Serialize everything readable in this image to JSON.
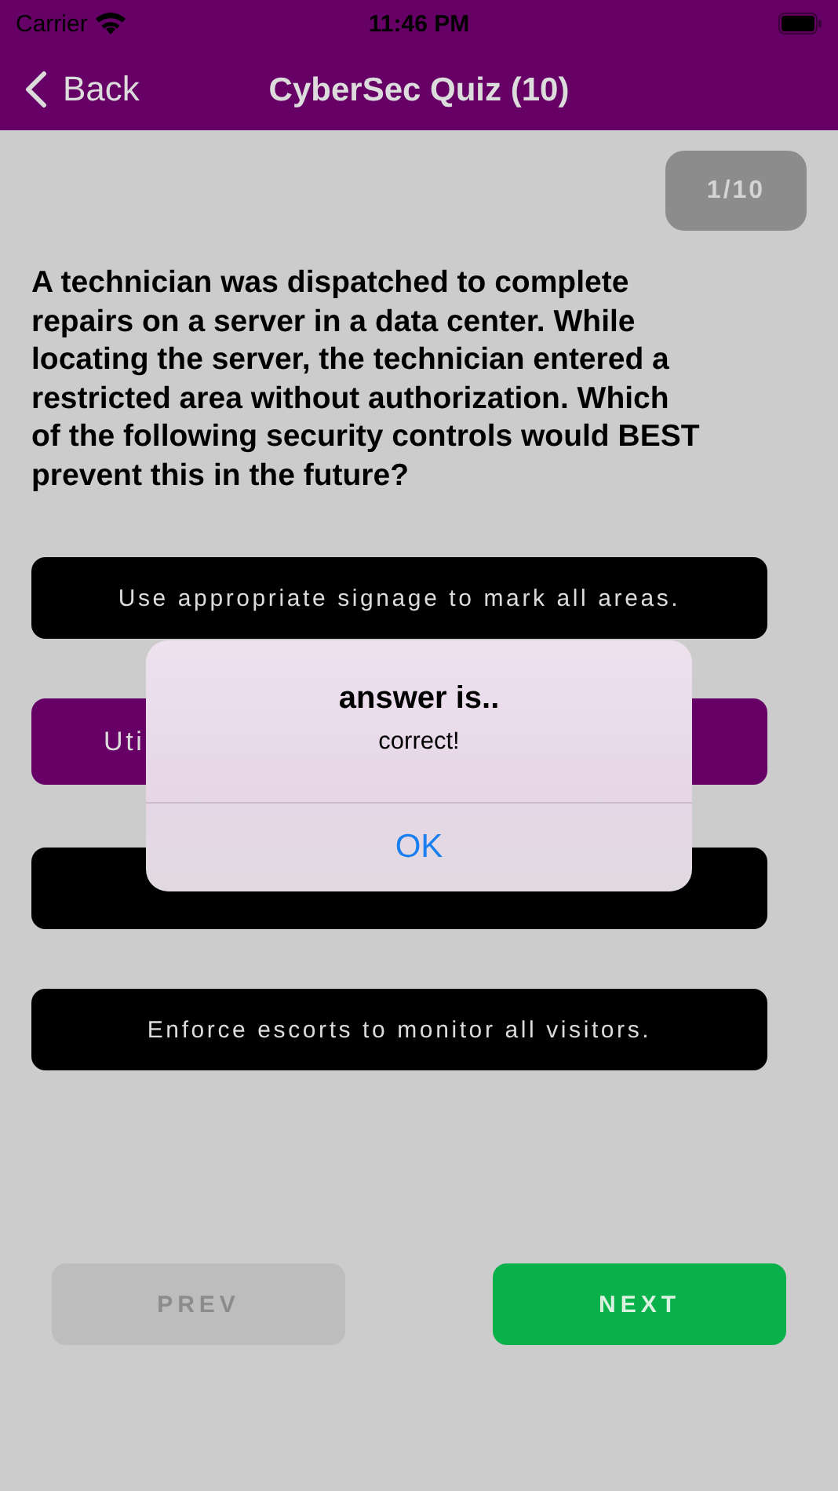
{
  "status_bar": {
    "carrier": "Carrier",
    "time": "11:46 PM"
  },
  "nav": {
    "back": "Back",
    "title": "CyberSec Quiz (10)"
  },
  "counter": "1/10",
  "question": "A technician was dispatched to complete repairs on a server in a data center. While locating the server, the technician entered a restricted area without authorization. Which of the following security controls would BEST prevent this in the future?",
  "options": [
    {
      "text": "Use appropriate signage to mark all areas.",
      "selected": false
    },
    {
      "text": "Uti",
      "selected": true,
      "partly_hidden": true
    },
    {
      "selected": false
    },
    {
      "text": "Enforce escorts to monitor all visitors.",
      "selected": false
    }
  ],
  "buttons": [
    {
      "label": "PREV",
      "disabled": true
    },
    {
      "label": "NEXT",
      "disabled": false
    }
  ],
  "alert": {
    "title": "answer is..",
    "message": "correct!",
    "button": "OK"
  }
}
